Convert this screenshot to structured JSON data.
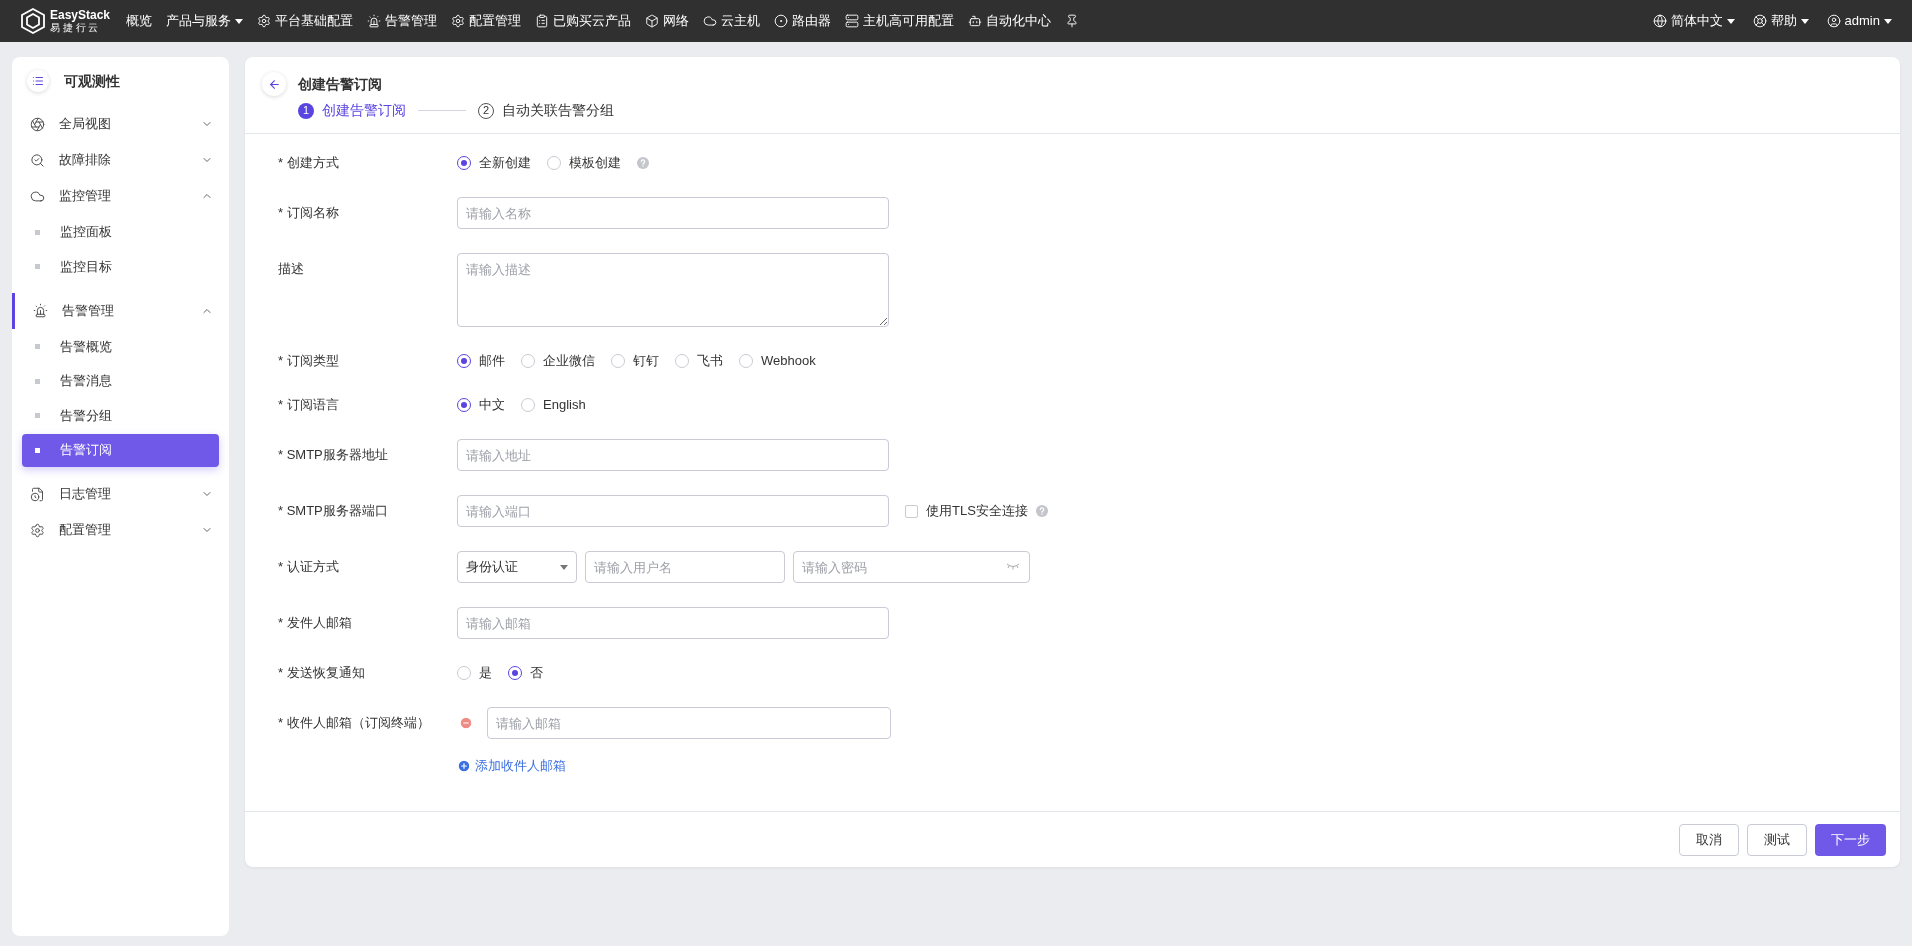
{
  "topbar": {
    "logo": {
      "name": "EasyStack",
      "subtitle": "易 捷 行 云"
    },
    "nav": [
      {
        "label": "概览",
        "dropdown": false
      },
      {
        "label": "产品与服务",
        "dropdown": true
      },
      {
        "label": "平台基础配置",
        "dropdown": false
      },
      {
        "label": "告警管理",
        "dropdown": false
      },
      {
        "label": "配置管理",
        "dropdown": false
      },
      {
        "label": "已购买云产品",
        "dropdown": false
      },
      {
        "label": "网络",
        "dropdown": false
      },
      {
        "label": "云主机",
        "dropdown": false
      },
      {
        "label": "路由器",
        "dropdown": false
      },
      {
        "label": "主机高可用配置",
        "dropdown": false
      },
      {
        "label": "自动化中心",
        "dropdown": false
      }
    ],
    "right": [
      {
        "label": "简体中文"
      },
      {
        "label": "帮助"
      },
      {
        "label": "admin"
      }
    ]
  },
  "sidebar": {
    "title": "可观测性",
    "items": [
      {
        "label": "全局视图",
        "expanded": false,
        "selected": false
      },
      {
        "label": "故障排除",
        "expanded": false,
        "selected": false
      },
      {
        "label": "监控管理",
        "expanded": true,
        "selected": false,
        "children": [
          {
            "label": "监控面板",
            "selected": false
          },
          {
            "label": "监控目标",
            "selected": false
          }
        ]
      },
      {
        "label": "告警管理",
        "expanded": true,
        "selected": true,
        "children": [
          {
            "label": "告警概览",
            "selected": false
          },
          {
            "label": "告警消息",
            "selected": false
          },
          {
            "label": "告警分组",
            "selected": false
          },
          {
            "label": "告警订阅",
            "selected": true
          }
        ]
      },
      {
        "label": "日志管理",
        "expanded": false,
        "selected": false
      },
      {
        "label": "配置管理",
        "expanded": false,
        "selected": false
      }
    ]
  },
  "page": {
    "title": "创建告警订阅",
    "steps": [
      {
        "number": "1",
        "label": "创建告警订阅",
        "selected": true
      },
      {
        "number": "2",
        "label": "自动关联告警分组",
        "selected": false
      }
    ],
    "form": [
      {
        "kind": "radio",
        "label": "* 创建方式",
        "help": true,
        "options": [
          {
            "label": "全新创建",
            "selected": true
          },
          {
            "label": "模板创建",
            "selected": false
          }
        ]
      },
      {
        "kind": "input",
        "label": "* 订阅名称",
        "placeholder": "请输入名称"
      },
      {
        "kind": "textarea",
        "label": "描述",
        "placeholder": "请输入描述"
      },
      {
        "kind": "radio",
        "label": "* 订阅类型",
        "options": [
          {
            "label": "邮件",
            "selected": true
          },
          {
            "label": "企业微信",
            "selected": false
          },
          {
            "label": "钉钉",
            "selected": false
          },
          {
            "label": "飞书",
            "selected": false
          },
          {
            "label": "Webhook",
            "selected": false
          }
        ]
      },
      {
        "kind": "radio",
        "label": "* 订阅语言",
        "options": [
          {
            "label": "中文",
            "selected": true
          },
          {
            "label": "English",
            "selected": false
          }
        ]
      },
      {
        "kind": "input",
        "label": "* SMTP服务器地址",
        "placeholder": "请输入地址"
      },
      {
        "kind": "input",
        "label": "* SMTP服务器端口",
        "placeholder": "请输入端口",
        "checkbox": {
          "label": "使用TLS安全连接",
          "checked": false,
          "help": true
        }
      },
      {
        "kind": "auth",
        "label": "* 认证方式",
        "select": "身份认证",
        "username_placeholder": "请输入用户名",
        "password_placeholder": "请输入密码"
      },
      {
        "kind": "input",
        "label": "* 发件人邮箱",
        "placeholder": "请输入邮箱"
      },
      {
        "kind": "radio",
        "label": "* 发送恢复通知",
        "options": [
          {
            "label": "是",
            "selected": false
          },
          {
            "label": "否",
            "selected": true
          }
        ]
      },
      {
        "kind": "recipients",
        "label": "* 收件人邮箱（订阅终端）",
        "entries": [
          {
            "placeholder": "请输入邮箱"
          }
        ],
        "add_link": "添加收件人邮箱"
      }
    ],
    "buttons": [
      {
        "label": "取消",
        "kind": "default"
      },
      {
        "label": "测试",
        "kind": "default"
      },
      {
        "label": "下一步",
        "kind": "primary"
      }
    ]
  }
}
